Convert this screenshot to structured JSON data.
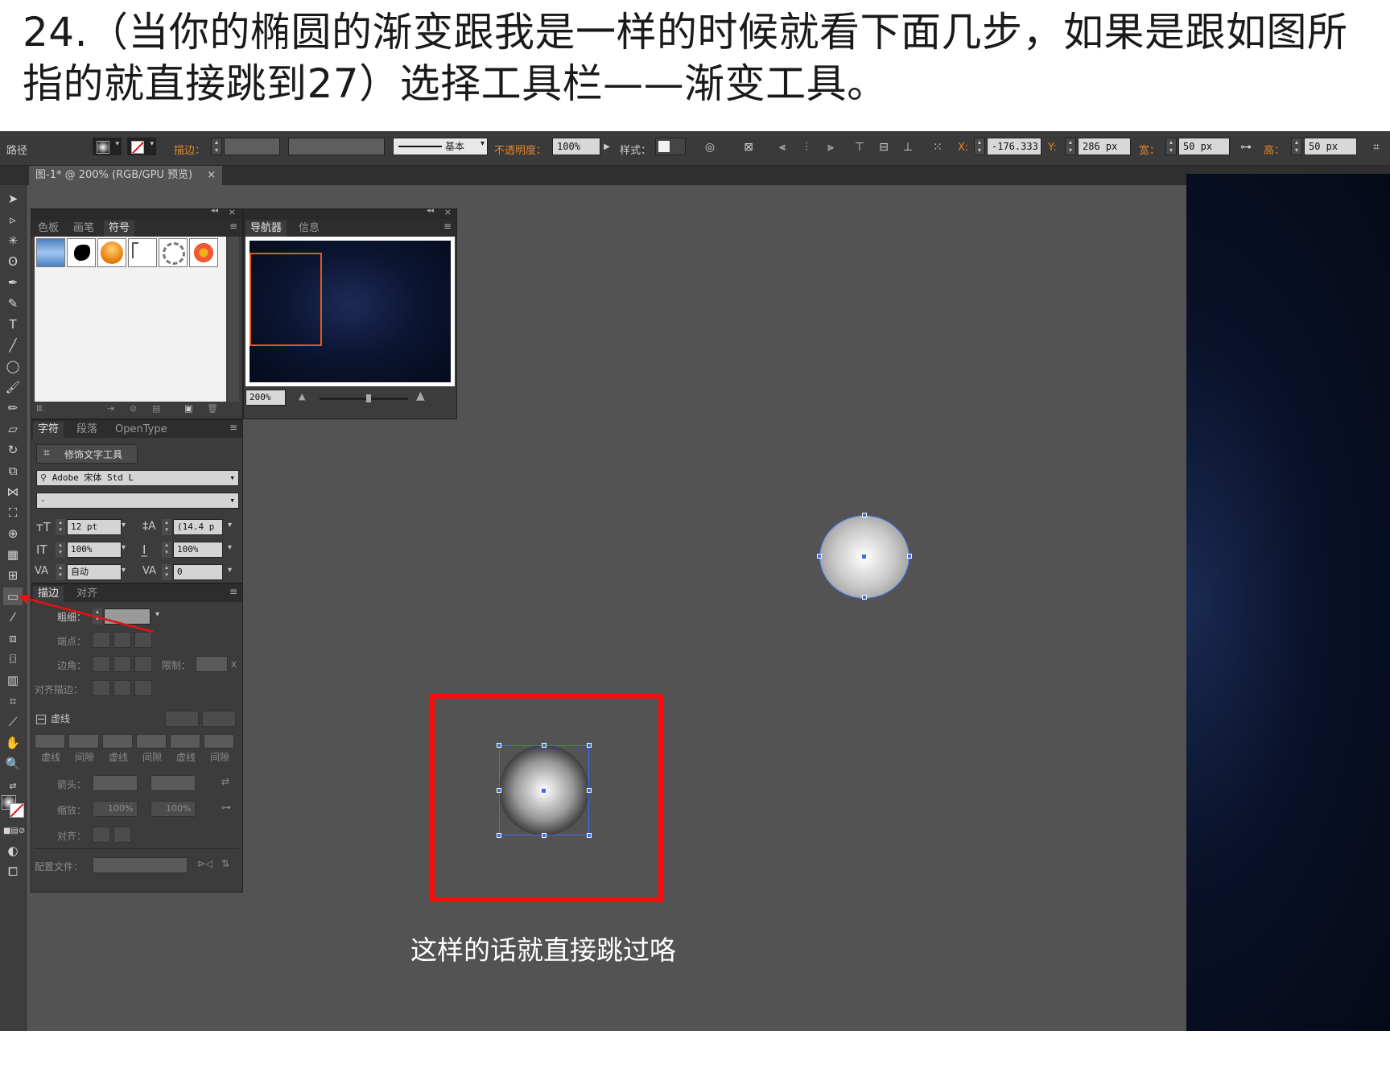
{
  "caption": {
    "line1": "24.（当你的椭圆的渐变跟我是一样的时候就看下面几步，如果是跟如图所",
    "line2": "指的就直接跳到27）选择工具栏——渐变工具。"
  },
  "control_bar": {
    "selection_type": "路径",
    "stroke_label": "描边：",
    "stroke_profile": "基本",
    "opacity_label": "不透明度：",
    "opacity_value": "100%",
    "style_label": "样式：",
    "x_label": "X:",
    "x_value": "-176.333",
    "y_label": "Y:",
    "y_value": "286 px",
    "w_label": "宽：",
    "w_value": "50 px",
    "h_label": "高：",
    "h_value": "50 px"
  },
  "document_tab": {
    "title": "图-1* @ 200% (RGB/GPU 预览)",
    "close": "×"
  },
  "swatch_panel": {
    "tabs": [
      "色板",
      "画笔",
      "符号"
    ],
    "active_tab": "符号"
  },
  "navigator_panel": {
    "tabs": [
      "导航器",
      "信息"
    ],
    "active_tab": "导航器",
    "zoom": "200%"
  },
  "character_panel": {
    "tabs": [
      "字符",
      "段落",
      "OpenType"
    ],
    "touch_type_button": "修饰文字工具",
    "font_family": "Adobe 宋体 Std L",
    "font_style": "-",
    "font_size": "12 pt",
    "leading": "(14.4 p",
    "vertical_scale": "100%",
    "horizontal_scale": "100%",
    "kerning": "自动",
    "tracking": "0"
  },
  "stroke_panel": {
    "tabs": [
      "描边",
      "对齐"
    ],
    "weight_label": "粗细：",
    "cap_label": "端点：",
    "corner_label": "边角：",
    "limit_label": "限制：",
    "limit_unit": "x",
    "align_label": "对齐描边：",
    "dashed_label": "虚线",
    "dash_cols": [
      "虚线",
      "间隙",
      "虚线",
      "间隙",
      "虚线",
      "间隙"
    ],
    "arrow_label": "箭头：",
    "scale_label": "缩放：",
    "scale_start": "100%",
    "scale_end": "100%",
    "arrow_align_label": "对齐：",
    "profile_label": "配置文件："
  },
  "canvas": {
    "annotation": "这样的话就直接跳过咯",
    "accent_red": "#ff0a0a",
    "selection_blue": "#3b6cf0",
    "background": "#535353"
  },
  "icons": {
    "close": "×",
    "collapse": "◂◂",
    "menu": "≡",
    "dropdown": "▾"
  }
}
